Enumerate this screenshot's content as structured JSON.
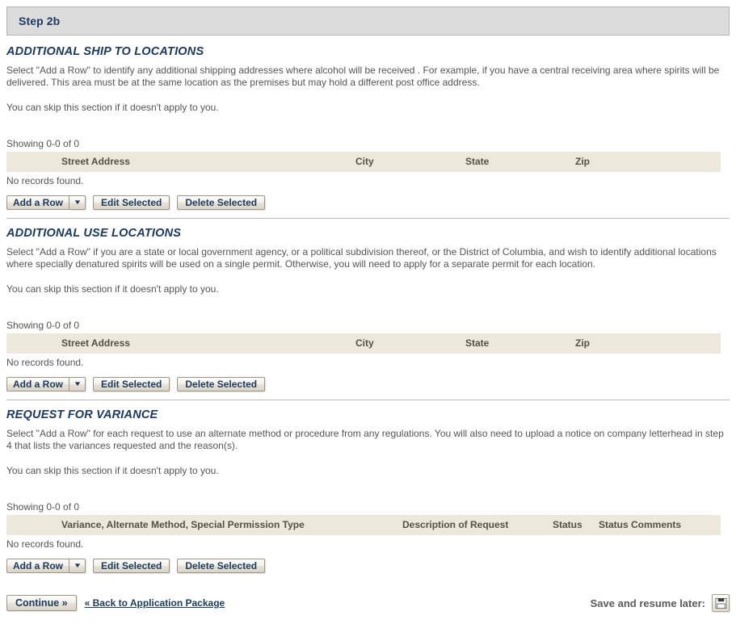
{
  "step": {
    "title": "Step 2b"
  },
  "sections": [
    {
      "heading": "ADDITIONAL SHIP TO LOCATIONS",
      "paragraph": "Select \"Add a Row\" to identify any additional shipping addresses where alcohol will be received . For example, if you have a central receiving area where spirits will be delivered. This area must be at the same location as the premises but may hold a different post office address.",
      "skip_note": "You can skip this section if it doesn't apply to you.",
      "showing": "Showing 0-0 of 0",
      "columns": [
        "Street Address",
        "City",
        "State",
        "Zip"
      ],
      "empty_message": "No records found.",
      "buttons": {
        "add_row": "Add a Row",
        "add_row_arrow": "▼",
        "edit_selected": "Edit Selected",
        "delete_selected": "Delete Selected"
      }
    },
    {
      "heading": "ADDITIONAL USE LOCATIONS",
      "paragraph": "Select \"Add a Row\" if you are a state or local government agency, or a political subdivision thereof, or the District of Columbia, and wish to identify additional locations where specially denatured spirits will be used on a single permit. Otherwise, you will need to apply for a separate permit for each location.",
      "skip_note": "You can skip this section if it doesn't apply to you.",
      "showing": "Showing 0-0 of 0",
      "columns": [
        "Street Address",
        "City",
        "State",
        "Zip"
      ],
      "empty_message": "No records found.",
      "buttons": {
        "add_row": "Add a Row",
        "add_row_arrow": "▼",
        "edit_selected": "Edit Selected",
        "delete_selected": "Delete Selected"
      }
    },
    {
      "heading": "REQUEST FOR VARIANCE",
      "paragraph": "Select \"Add a Row\" for each request to use an alternate method or procedure from any regulations. You will also need to upload a notice on company letterhead in step 4 that lists the variances requested and the reason(s).",
      "skip_note": "You can skip this section if it doesn't apply to you.",
      "showing": "Showing 0-0 of 0",
      "columns": [
        "Variance, Alternate Method, Special Permission Type",
        "Description of Request",
        "Status",
        "Status Comments"
      ],
      "empty_message": "No records found.",
      "buttons": {
        "add_row": "Add a Row",
        "add_row_arrow": "▼",
        "edit_selected": "Edit Selected",
        "delete_selected": "Delete Selected"
      }
    }
  ],
  "footer": {
    "continue_label": "Continue »",
    "back_link": "« Back to Application Package",
    "save_label": "Save and resume later:",
    "save_icon": "floppy-disk-icon"
  },
  "colors": {
    "heading_blue": "#1b3a63",
    "step_bar_bg": "#dcdcdc",
    "table_header_bg": "#ece8dc",
    "body_text": "#555555"
  }
}
